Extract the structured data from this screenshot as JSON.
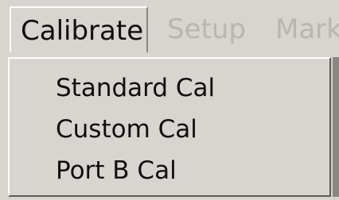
{
  "menubar": {
    "items": [
      {
        "label": "Calibrate",
        "state": "open"
      },
      {
        "label": "Setup",
        "state": "disabled"
      },
      {
        "label": "Mark",
        "state": "disabled"
      }
    ]
  },
  "dropdown": {
    "items": [
      {
        "label": "Standard Cal"
      },
      {
        "label": "Custom Cal"
      },
      {
        "label": "Port B Cal"
      }
    ]
  },
  "colors": {
    "background": "#d8d4cf",
    "text": "#0f0f0f",
    "disabled_text": "#b9b5b0",
    "highlight": "#ffffff",
    "shadow": "#5e5b57"
  }
}
